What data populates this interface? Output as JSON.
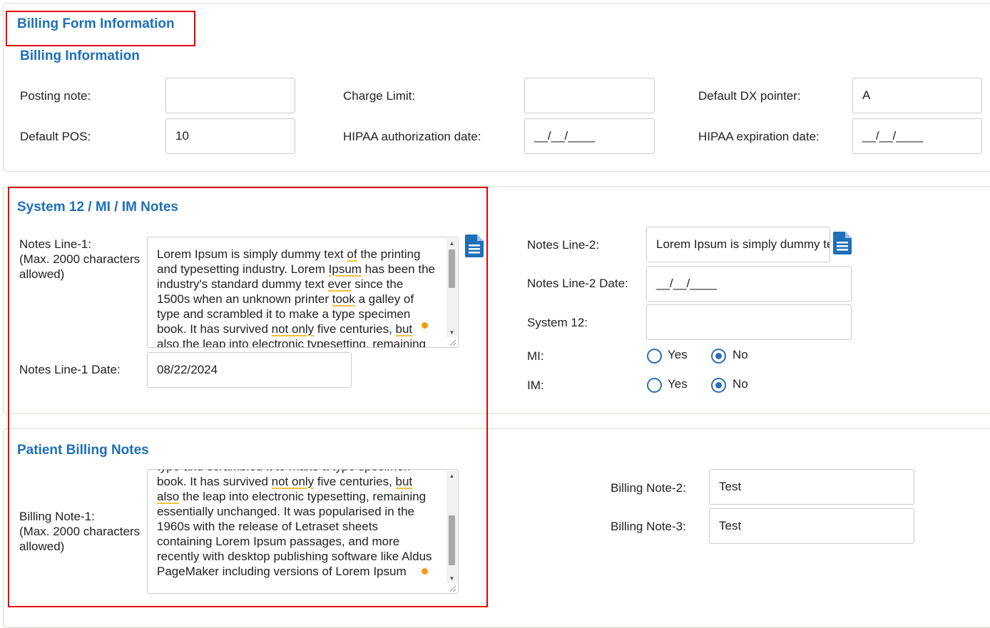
{
  "header": {
    "title": "Billing Form Information"
  },
  "billing_info": {
    "title": "Billing Information",
    "posting_note": {
      "label": "Posting note:",
      "value": ""
    },
    "charge_limit": {
      "label": "Charge Limit:",
      "value": ""
    },
    "default_dx_pointer": {
      "label": "Default DX pointer:",
      "value": "A"
    },
    "default_pos": {
      "label": "Default POS:",
      "value": "10"
    },
    "hipaa_auth_date": {
      "label": "HIPAA authorization date:",
      "value": "__/__/____"
    },
    "hipaa_exp_date": {
      "label": "HIPAA expiration date:",
      "value": "__/__/____"
    }
  },
  "system_notes": {
    "title": "System 12 / MI / IM Notes",
    "notes_line1": {
      "label": "Notes Line-1:",
      "sublabel": "(Max. 2000 characters allowed)",
      "parts": [
        "Lorem Ipsum is simply dummy text ",
        "of",
        " the printing and typesetting industry. Lorem ",
        "Ipsum",
        " has been the industry's standard dummy text ",
        "ever",
        " since the 1500s when an unknown printer ",
        "took",
        " a galley of type and scrambled it to make a type specimen book. It has survived ",
        "not only",
        " five centuries, ",
        "but",
        " also the leap into electronic typesetting, remaining essentially unchanged."
      ]
    },
    "notes_line1_date": {
      "label": "Notes Line-1 Date:",
      "value": "08/22/2024"
    },
    "notes_line2": {
      "label": "Notes Line-2:",
      "value": "Lorem Ipsum is simply dummy text of the printing"
    },
    "notes_line2_date": {
      "label": "Notes Line-2 Date:",
      "value": "__/__/____"
    },
    "system12": {
      "label": "System 12:",
      "value": ""
    },
    "mi": {
      "label": "MI:",
      "yes": "Yes",
      "no": "No",
      "selected": "No"
    },
    "im": {
      "label": "IM:",
      "yes": "Yes",
      "no": "No",
      "selected": "No"
    }
  },
  "patient_billing": {
    "title": "Patient Billing Notes",
    "billing_note1": {
      "label": "Billing Note-1:",
      "sublabel": "(Max. 2000 characters allowed)",
      "parts": [
        "type and scrambled it to make a type specimen book. It has survived ",
        "not only",
        " five centuries, ",
        "but",
        " ",
        "also",
        " the leap into electronic typesetting, remaining essentially unchanged. It was popularised in the 1960s with the release of Letraset sheets containing Lorem Ipsum passages, and more recently with desktop publishing software like Aldus PageMaker including versions of Lorem Ipsum"
      ]
    },
    "billing_note2": {
      "label": "Billing Note-2:",
      "value": "Test"
    },
    "billing_note3": {
      "label": "Billing Note-3:",
      "value": "Test"
    }
  },
  "icons": {
    "doc": "document-icon",
    "up": "scroll-up-arrow-icon",
    "down": "scroll-down-arrow-icon"
  },
  "colors": {
    "accent": "#1e6fb8",
    "highlight_box": "#e00000",
    "panel_border": "#cfe3cf",
    "radio": "#2d6db4"
  }
}
